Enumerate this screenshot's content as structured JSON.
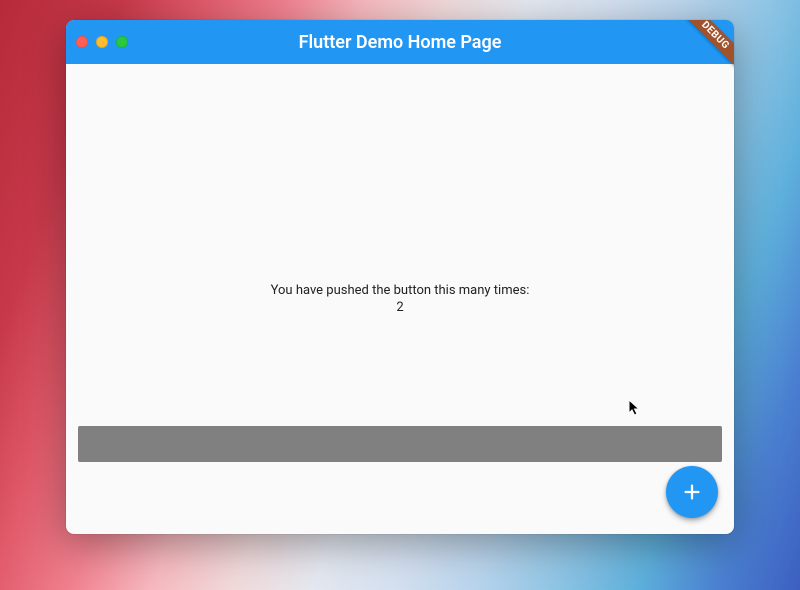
{
  "window": {
    "title": "Flutter Demo Home Page",
    "debug_label": "DEBUG"
  },
  "counter": {
    "label": "You have pushed the button this many times:",
    "value": "2"
  },
  "fab": {
    "icon": "plus-icon"
  },
  "colors": {
    "primary": "#2196f3",
    "surface": "#fafafa",
    "bar": "#808080"
  }
}
